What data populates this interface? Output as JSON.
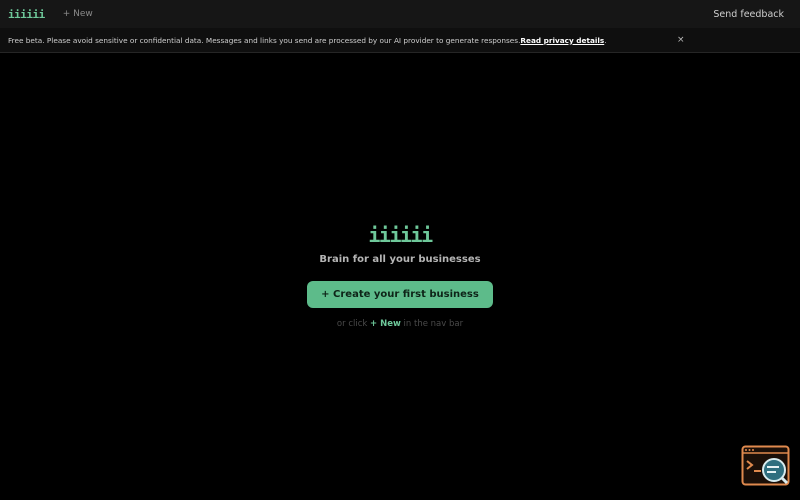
{
  "topbar": {
    "logo": "iiiiii",
    "new_label": "+ New",
    "feedback_label": "Send feedback"
  },
  "banner": {
    "text": "Free beta. Please avoid sensitive or confidential data. Messages and links you send are processed by our AI provider to generate responses. ",
    "link_label": "Read privacy details",
    "link_suffix": ".",
    "close_label": "×"
  },
  "empty_state": {
    "logo": "iiiiii",
    "tagline": "Brain for all your businesses",
    "create_button_label": "+ Create your first business",
    "hint_prefix": "or click ",
    "hint_link": "+ New",
    "hint_suffix": " in the nav bar"
  },
  "widget": {
    "icon": "terminal-search-icon"
  },
  "colors": {
    "accent": "#6ec89a",
    "button_bg": "#5dbb8a",
    "topbar_bg": "#161616",
    "page_bg": "#000000",
    "widget_orange": "#e08a4e",
    "widget_teal": "#2f6f7f"
  }
}
